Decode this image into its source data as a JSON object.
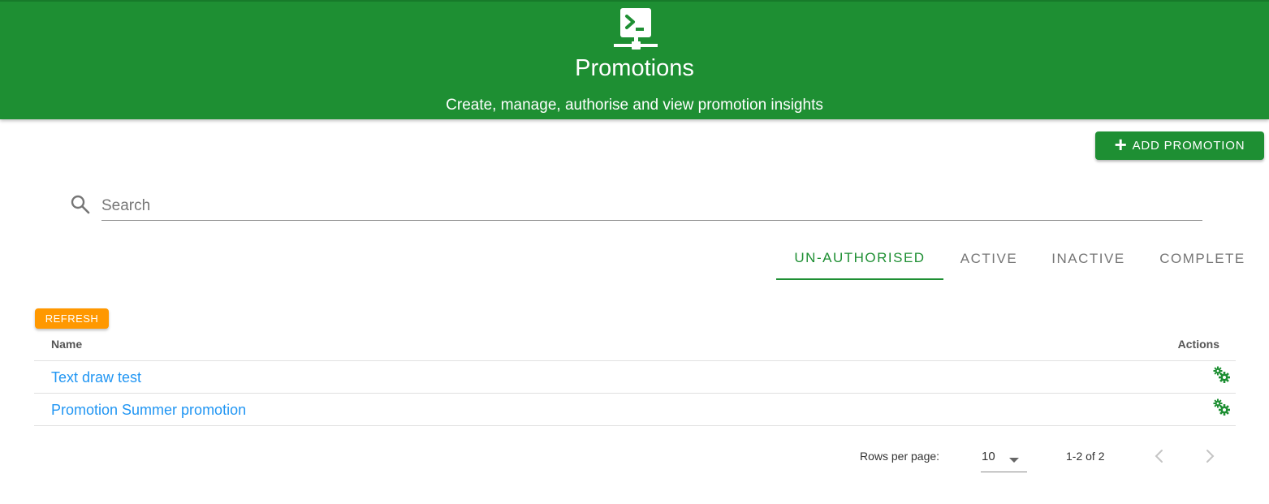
{
  "header": {
    "icon": "terminal-network-icon",
    "title": "Promotions",
    "subtitle": "Create, manage, authorise and view promotion insights",
    "background_color": "#1e8f33"
  },
  "toolbar": {
    "add_label": "ADD PROMOTION",
    "add_icon": "plus-icon"
  },
  "search": {
    "placeholder": "Search",
    "value": "",
    "icon": "search-icon"
  },
  "tabs": [
    {
      "label": "UN-AUTHORISED",
      "active": true
    },
    {
      "label": "ACTIVE",
      "active": false
    },
    {
      "label": "INACTIVE",
      "active": false
    },
    {
      "label": "COMPLETE",
      "active": false
    }
  ],
  "refresh_label": "REFRESH",
  "table": {
    "columns": [
      "Name",
      "Actions"
    ],
    "rows": [
      {
        "name": "Text draw test",
        "action_icon": "cogs-icon"
      },
      {
        "name": "Promotion Summer promotion",
        "action_icon": "cogs-icon"
      }
    ]
  },
  "pagination": {
    "rows_per_page_label": "Rows per page:",
    "rows_per_page": "10",
    "range": "1-2 of 2"
  },
  "colors": {
    "accent": "#1e8f33",
    "refresh": "#ff9800",
    "link": "#2196f3"
  }
}
